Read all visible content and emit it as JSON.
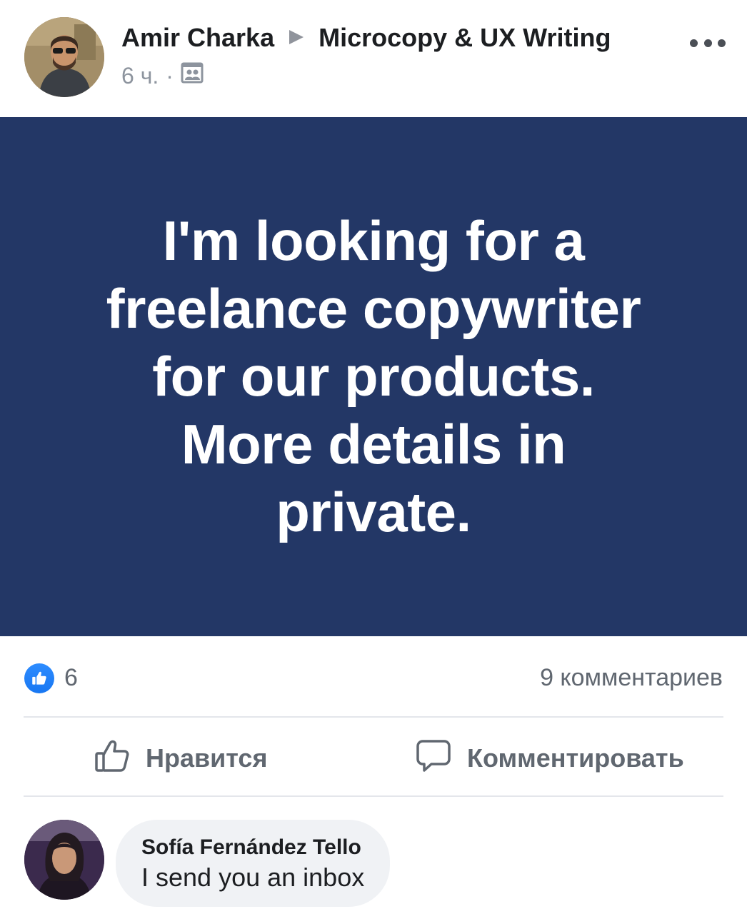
{
  "post": {
    "author": "Amir Charka",
    "group": "Microcopy & UX Writing",
    "time": "6 ч.",
    "separator": "·",
    "audience_icon": "group-icon",
    "more_icon": "more-icon"
  },
  "banner": {
    "lines": [
      "I'm looking for a",
      "freelance copywriter",
      "for our products.",
      "More details in",
      "private."
    ],
    "background_color": "#233766",
    "text_color": "#ffffff"
  },
  "stats": {
    "likes": "6",
    "comments": "9 комментариев"
  },
  "actions": {
    "like_label": "Нравится",
    "comment_label": "Комментировать"
  },
  "comment": {
    "author": "Sofía Fernández Tello",
    "text": "I send you an inbox"
  },
  "colors": {
    "accent": "#1877f2",
    "muted_text": "#606770",
    "bubble": "#f0f2f5"
  }
}
